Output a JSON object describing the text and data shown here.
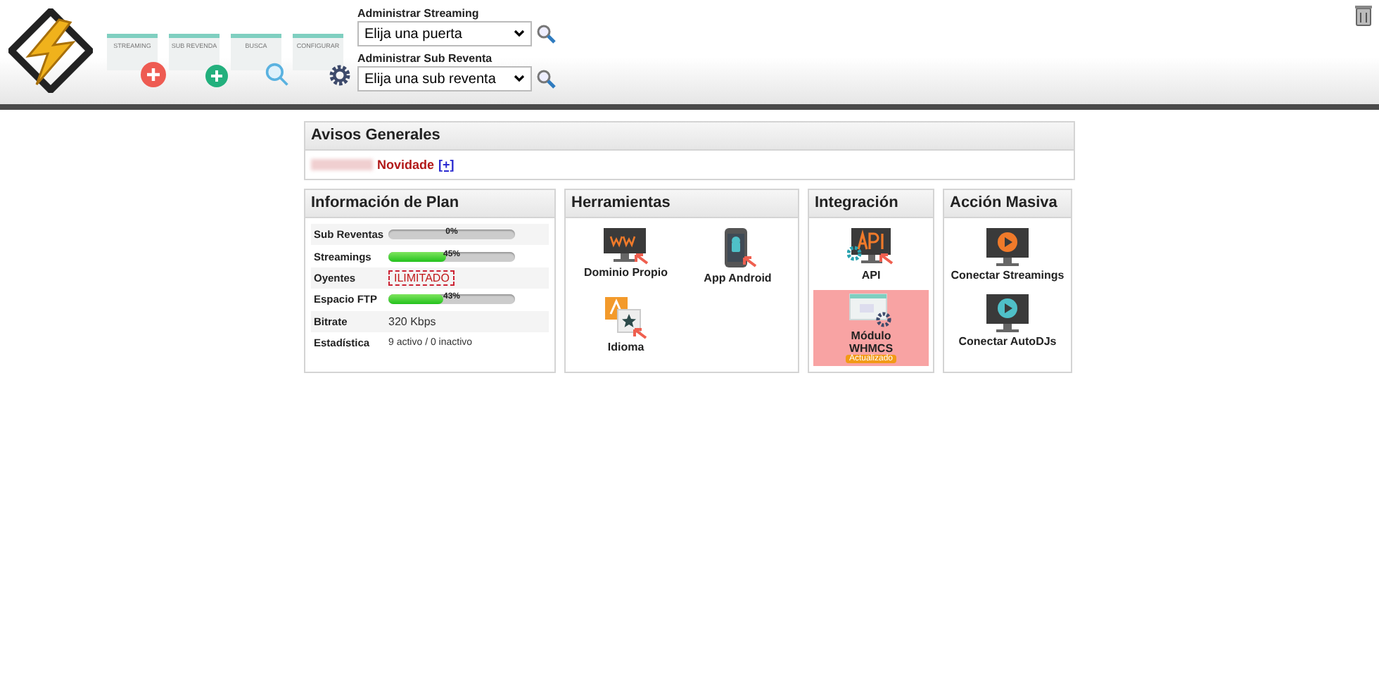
{
  "header": {
    "shortcuts": [
      {
        "kind": "streaming",
        "label": "STREAMING"
      },
      {
        "kind": "subrevenda",
        "label": "SUB REVENDA"
      },
      {
        "kind": "busca",
        "label": "BUSCA"
      },
      {
        "kind": "config",
        "label": "CONFIGURAR"
      }
    ],
    "selectors": [
      {
        "label": "Administrar Streaming",
        "value": "Elija una puerta"
      },
      {
        "label": "Administrar Sub Reventa",
        "value": "Elija una sub reventa"
      }
    ]
  },
  "notices": {
    "title": "Avisos Generales",
    "items": [
      {
        "text": "Novidade",
        "link": "[+]"
      }
    ]
  },
  "plan": {
    "title": "Información de Plan",
    "rows": [
      {
        "label": "Sub Reventas",
        "kind": "bar",
        "value": "0%"
      },
      {
        "label": "Streamings",
        "kind": "bar",
        "level": 0.45,
        "value": "45%"
      },
      {
        "label": "Oyentes",
        "kind": "badge",
        "value": "ILIMITADO"
      },
      {
        "label": "Espacio FTP",
        "kind": "bar",
        "level": 0.43,
        "value": "43%"
      },
      {
        "label": "Bitrate",
        "kind": "text",
        "value": "320 Kbps"
      },
      {
        "label": "Estadística",
        "kind": "small",
        "value": "9 activo / 0 inactivo"
      }
    ]
  },
  "panels": [
    {
      "title": "Herramientas",
      "kind": "grid",
      "items": [
        {
          "kind": "www",
          "label": "Dominio Propio",
          "highlighted": false
        },
        {
          "kind": "android",
          "label": "App Android",
          "highlighted": false
        },
        {
          "kind": "language",
          "label": "Idioma",
          "highlighted": false
        }
      ]
    },
    {
      "title": "Integración",
      "kind": "stack",
      "items": [
        {
          "kind": "api",
          "label": "API",
          "highlighted": false
        },
        {
          "kind": "whmcs",
          "label": "Módulo WHMCS",
          "badge": "Actualizado",
          "highlighted": true
        }
      ]
    },
    {
      "title": "Acción Masiva",
      "kind": "stack",
      "items": [
        {
          "kind": "play-orange",
          "label": "Conectar Streamings",
          "highlighted": false
        },
        {
          "kind": "play-teal",
          "label": "Conectar AutoDJs",
          "highlighted": false
        }
      ]
    }
  ]
}
